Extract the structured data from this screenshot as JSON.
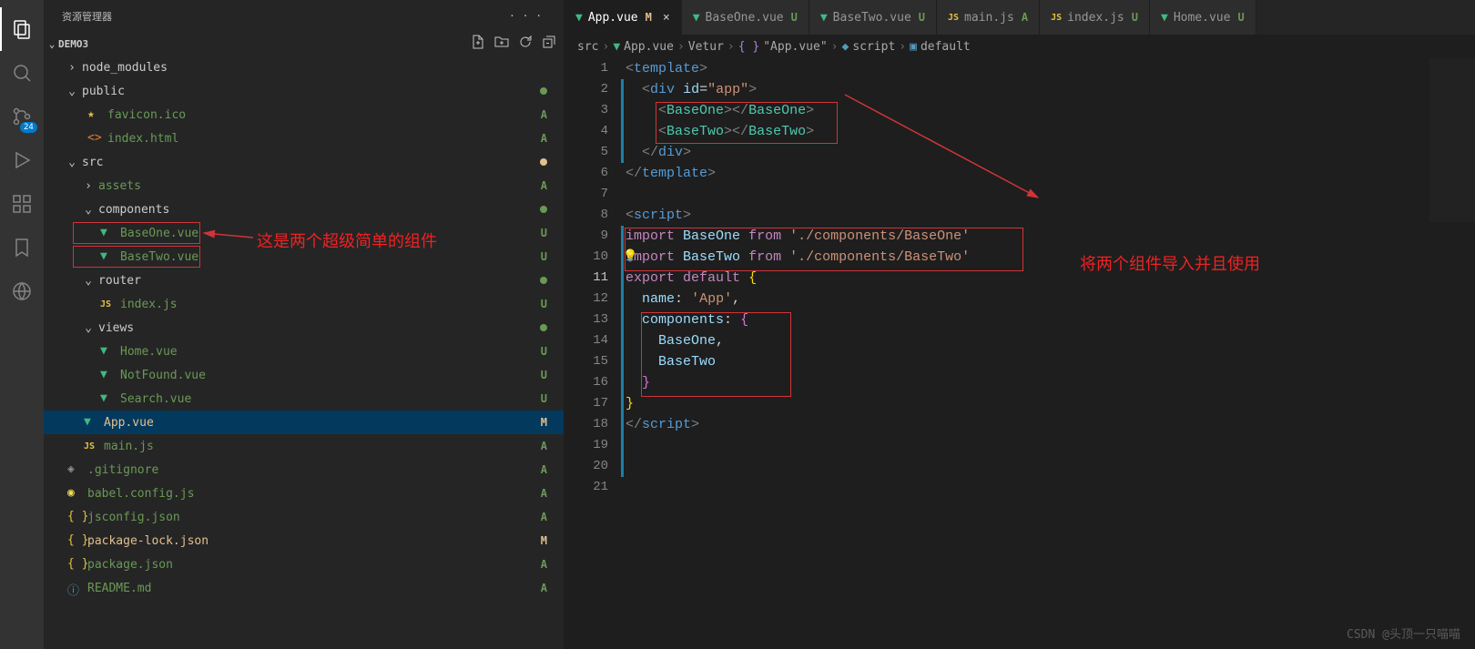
{
  "explorer": {
    "title": "资源管理器",
    "section": "DEMO3",
    "badge": "24",
    "items": [
      {
        "type": "folder",
        "name": "node_modules",
        "indent": 18,
        "chev": ">",
        "status": ""
      },
      {
        "type": "folder",
        "name": "public",
        "indent": 18,
        "chev": "v",
        "status": "",
        "dot": "green"
      },
      {
        "type": "file",
        "name": "favicon.ico",
        "indent": 40,
        "icon": "star",
        "status": "A",
        "cls": "file-green"
      },
      {
        "type": "file",
        "name": "index.html",
        "indent": 40,
        "icon": "html",
        "status": "A",
        "cls": "file-green"
      },
      {
        "type": "folder",
        "name": "src",
        "indent": 18,
        "chev": "v",
        "status": "",
        "dot": "yellow"
      },
      {
        "type": "folder",
        "name": "assets",
        "indent": 36,
        "chev": ">",
        "status": "A",
        "cls": "file-green"
      },
      {
        "type": "folder",
        "name": "components",
        "indent": 36,
        "chev": "v",
        "status": "",
        "dot": "green"
      },
      {
        "type": "file",
        "name": "BaseOne.vue",
        "indent": 54,
        "icon": "vue",
        "status": "U",
        "cls": "file-green"
      },
      {
        "type": "file",
        "name": "BaseTwo.vue",
        "indent": 54,
        "icon": "vue",
        "status": "U",
        "cls": "file-green"
      },
      {
        "type": "folder",
        "name": "router",
        "indent": 36,
        "chev": "v",
        "status": "",
        "dot": "green"
      },
      {
        "type": "file",
        "name": "index.js",
        "indent": 54,
        "icon": "js",
        "status": "U",
        "cls": "file-green"
      },
      {
        "type": "folder",
        "name": "views",
        "indent": 36,
        "chev": "v",
        "status": "",
        "dot": "green"
      },
      {
        "type": "file",
        "name": "Home.vue",
        "indent": 54,
        "icon": "vue",
        "status": "U",
        "cls": "file-green"
      },
      {
        "type": "file",
        "name": "NotFound.vue",
        "indent": 54,
        "icon": "vue",
        "status": "U",
        "cls": "file-green"
      },
      {
        "type": "file",
        "name": "Search.vue",
        "indent": 54,
        "icon": "vue",
        "status": "U",
        "cls": "file-green"
      },
      {
        "type": "file",
        "name": "App.vue",
        "indent": 36,
        "icon": "vue",
        "status": "M",
        "cls": "file-mod",
        "selected": true
      },
      {
        "type": "file",
        "name": "main.js",
        "indent": 36,
        "icon": "js",
        "status": "A",
        "cls": "file-green"
      },
      {
        "type": "file",
        "name": ".gitignore",
        "indent": 18,
        "icon": "git",
        "status": "A",
        "cls": "file-green"
      },
      {
        "type": "file",
        "name": "babel.config.js",
        "indent": 18,
        "icon": "babel",
        "status": "A",
        "cls": "file-green"
      },
      {
        "type": "file",
        "name": "jsconfig.json",
        "indent": 18,
        "icon": "json",
        "status": "A",
        "cls": "file-green"
      },
      {
        "type": "file",
        "name": "package-lock.json",
        "indent": 18,
        "icon": "json",
        "status": "M",
        "cls": "file-mod"
      },
      {
        "type": "file",
        "name": "package.json",
        "indent": 18,
        "icon": "json",
        "status": "A",
        "cls": "file-green"
      },
      {
        "type": "file",
        "name": "README.md",
        "indent": 18,
        "icon": "info",
        "status": "A",
        "cls": "file-green"
      }
    ]
  },
  "tabs": [
    {
      "icon": "vue",
      "label": "App.vue",
      "status": "M",
      "statusCls": "",
      "active": true,
      "close": true
    },
    {
      "icon": "vue",
      "label": "BaseOne.vue",
      "status": "U",
      "statusCls": "u"
    },
    {
      "icon": "vue",
      "label": "BaseTwo.vue",
      "status": "U",
      "statusCls": "u"
    },
    {
      "icon": "js",
      "label": "main.js",
      "status": "A",
      "statusCls": "a"
    },
    {
      "icon": "js",
      "label": "index.js",
      "status": "U",
      "statusCls": "u"
    },
    {
      "icon": "vue",
      "label": "Home.vue",
      "status": "U",
      "statusCls": "u"
    }
  ],
  "breadcrumb": {
    "p0": "src",
    "p1": "App.vue",
    "p2": "Vetur",
    "p3": "\"App.vue\"",
    "p4": "script",
    "p5": "default"
  },
  "code": {
    "lines": [
      "<span class='c-tag'>&lt;</span><span class='c-el'>template</span><span class='c-tag'>&gt;</span>",
      "  <span class='c-tag'>&lt;</span><span class='c-el'>div</span> <span class='c-attr'>id</span><span class='c-punc'>=</span><span class='c-str'>\"app\"</span><span class='c-tag'>&gt;</span>",
      "    <span class='c-tag'>&lt;</span><span class='c-comp'>BaseOne</span><span class='c-tag'>&gt;&lt;/</span><span class='c-comp'>BaseOne</span><span class='c-tag'>&gt;</span>",
      "    <span class='c-tag'>&lt;</span><span class='c-comp'>BaseTwo</span><span class='c-tag'>&gt;&lt;/</span><span class='c-comp'>BaseTwo</span><span class='c-tag'>&gt;</span>",
      "  <span class='c-tag'>&lt;/</span><span class='c-el'>div</span><span class='c-tag'>&gt;</span>",
      "<span class='c-tag'>&lt;/</span><span class='c-el'>template</span><span class='c-tag'>&gt;</span>",
      "",
      "<span class='c-tag'>&lt;</span><span class='c-el'>script</span><span class='c-tag'>&gt;</span>",
      "<span class='c-kw'>import</span> <span class='c-var'>BaseOne</span> <span class='c-kw'>from</span> <span class='c-str'>'./components/BaseOne'</span>",
      "<span class='c-kw'>import</span> <span class='c-var'>BaseTwo</span> <span class='c-kw'>from</span> <span class='c-str'>'./components/BaseTwo'</span>",
      "<span class='c-kw'>export</span> <span class='c-kw'>default</span> <span class='c-brace'>{</span>",
      "  <span class='c-var'>name</span><span class='c-punc'>:</span> <span class='c-str'>'App'</span><span class='c-punc'>,</span>",
      "  <span class='c-var'>components</span><span class='c-punc'>:</span> <span class='c-bracep'>{</span>",
      "    <span class='c-var'>BaseOne</span><span class='c-punc'>,</span>",
      "    <span class='c-var'>BaseTwo</span>",
      "  <span class='c-bracep'>}</span>",
      "<span class='c-brace'>}</span>",
      "<span class='c-tag'>&lt;/</span><span class='c-el'>script</span><span class='c-tag'>&gt;</span>",
      "",
      "",
      ""
    ]
  },
  "annotations": {
    "text1": "这是两个超级简单的组件",
    "text2": "将两个组件导入并且使用"
  },
  "credit": "CSDN @头顶一只喵喵"
}
